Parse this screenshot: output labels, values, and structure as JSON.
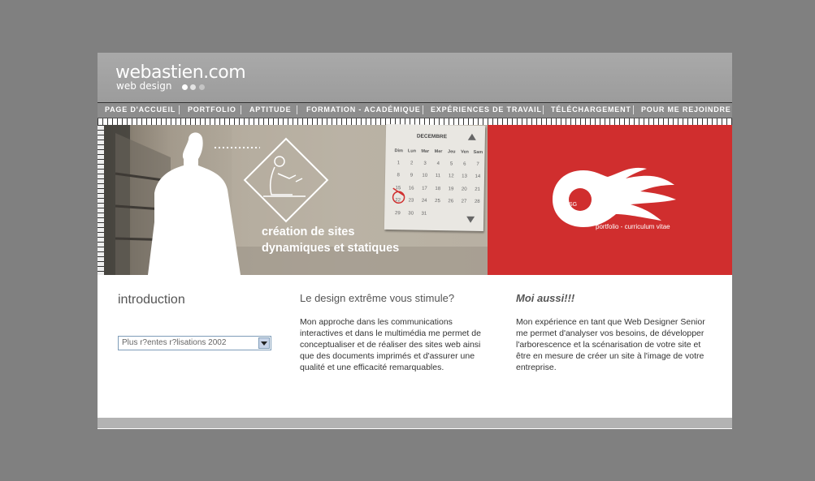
{
  "header": {
    "logo_main": "webastien.com",
    "logo_sub": "web design",
    "dots": [
      "#ffffff",
      "#e4e4e4",
      "#c4c4c4"
    ]
  },
  "nav": {
    "items": [
      {
        "label": "PAGE D'ACCUEIL"
      },
      {
        "label": "PORTFOLIO"
      },
      {
        "label": "APTITUDE"
      },
      {
        "label": "FORMATION - ACADÉMIQUE"
      },
      {
        "label": "EXPÉRIENCES DE TRAVAIL"
      },
      {
        "label": "TÉLÉCHARGEMENT"
      },
      {
        "label": "POUR ME REJOINDRE"
      }
    ]
  },
  "banner": {
    "text_line1": "création de sites",
    "text_line2": "dynamiques et statiques",
    "calendar": {
      "month": "DECEMBRE",
      "days": [
        "Dim",
        "Lun",
        "Mar",
        "Mer",
        "Jeu",
        "Ven",
        "Sam"
      ],
      "weeks": [
        [
          "",
          "",
          "",
          "",
          "",
          "",
          ""
        ],
        [
          "1",
          "2",
          "3",
          "4",
          "5",
          "6",
          "7"
        ],
        [
          "8",
          "9",
          "10",
          "11",
          "12",
          "13",
          "14"
        ],
        [
          "15",
          "16",
          "17",
          "18",
          "19",
          "20",
          "21"
        ],
        [
          "22",
          "23",
          "24",
          "25",
          "26",
          "27",
          "28"
        ],
        [
          "29",
          "30",
          "31",
          "",
          "",
          "",
          ""
        ]
      ]
    },
    "logo_initials": "SG",
    "portfolio_caption": "portfolio - curriculum vitae",
    "colors": {
      "red": "#d02e2e"
    }
  },
  "content": {
    "col1": {
      "title": "introduction",
      "select_value": "Plus r?entes r?lisations 2002"
    },
    "col2": {
      "title": "Le design extrême vous stimule?",
      "text": "Mon approche dans les communications interactives et dans le multimédia me permet de conceptualiser et de réaliser des sites web ainsi que des documents imprimés et d'assurer une qualité et une efficacité remarquables."
    },
    "col3": {
      "title": "Moi aussi!!!",
      "text": "Mon expérience en tant que Web Designer Senior me permet d'analyser vos besoins, de développer l'arborescence et la scénarisation de votre site et être en mesure de créer un site à l'image de votre entreprise."
    }
  }
}
